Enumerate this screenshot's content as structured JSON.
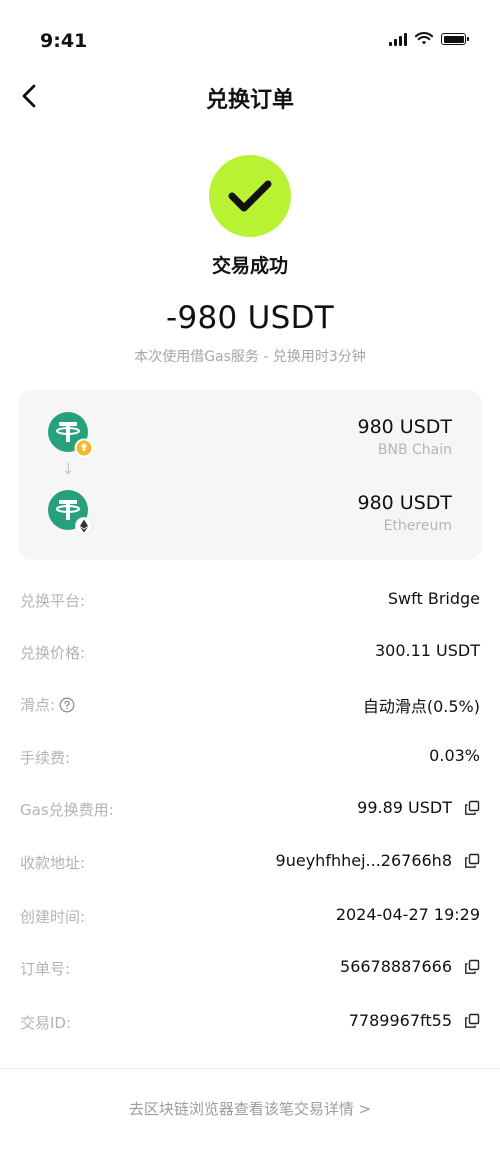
{
  "status_bar": {
    "time": "9:41"
  },
  "nav": {
    "title": "兑换订单"
  },
  "result": {
    "status": "交易成功",
    "amount": "-980 USDT",
    "note": "本次使用借Gas服务 - 兑换用时3分钟"
  },
  "swap": {
    "from": {
      "amount": "980 USDT",
      "chain": "BNB Chain",
      "icon": "usdt-bnb-icon"
    },
    "to": {
      "amount": "980 USDT",
      "chain": "Ethereum",
      "icon": "usdt-eth-icon"
    }
  },
  "details": {
    "platform": {
      "label": "兑换平台:",
      "value": "Swft Bridge"
    },
    "price": {
      "label": "兑换价格:",
      "value": "300.11 USDT"
    },
    "slippage": {
      "label": "滑点:",
      "value": "自动滑点(0.5%)"
    },
    "fee": {
      "label": "手续费:",
      "value": "0.03%"
    },
    "gas_fee": {
      "label": "Gas兑换费用:",
      "value": "99.89 USDT"
    },
    "address": {
      "label": "收款地址:",
      "value": "9ueyhfhhej...26766h8"
    },
    "created": {
      "label": "创建时间:",
      "value": "2024-04-27 19:29"
    },
    "order_no": {
      "label": "订单号:",
      "value": "56678887666"
    },
    "tx_id": {
      "label": "交易ID:",
      "value": "7789967ft55"
    }
  },
  "footer": {
    "explorer_link": "去区块链浏览器查看该笔交易详情 >"
  },
  "colors": {
    "accent": "#b8f232",
    "tether": "#26a17b",
    "bnb": "#f3ba2f",
    "muted": "#b4b4b4"
  }
}
